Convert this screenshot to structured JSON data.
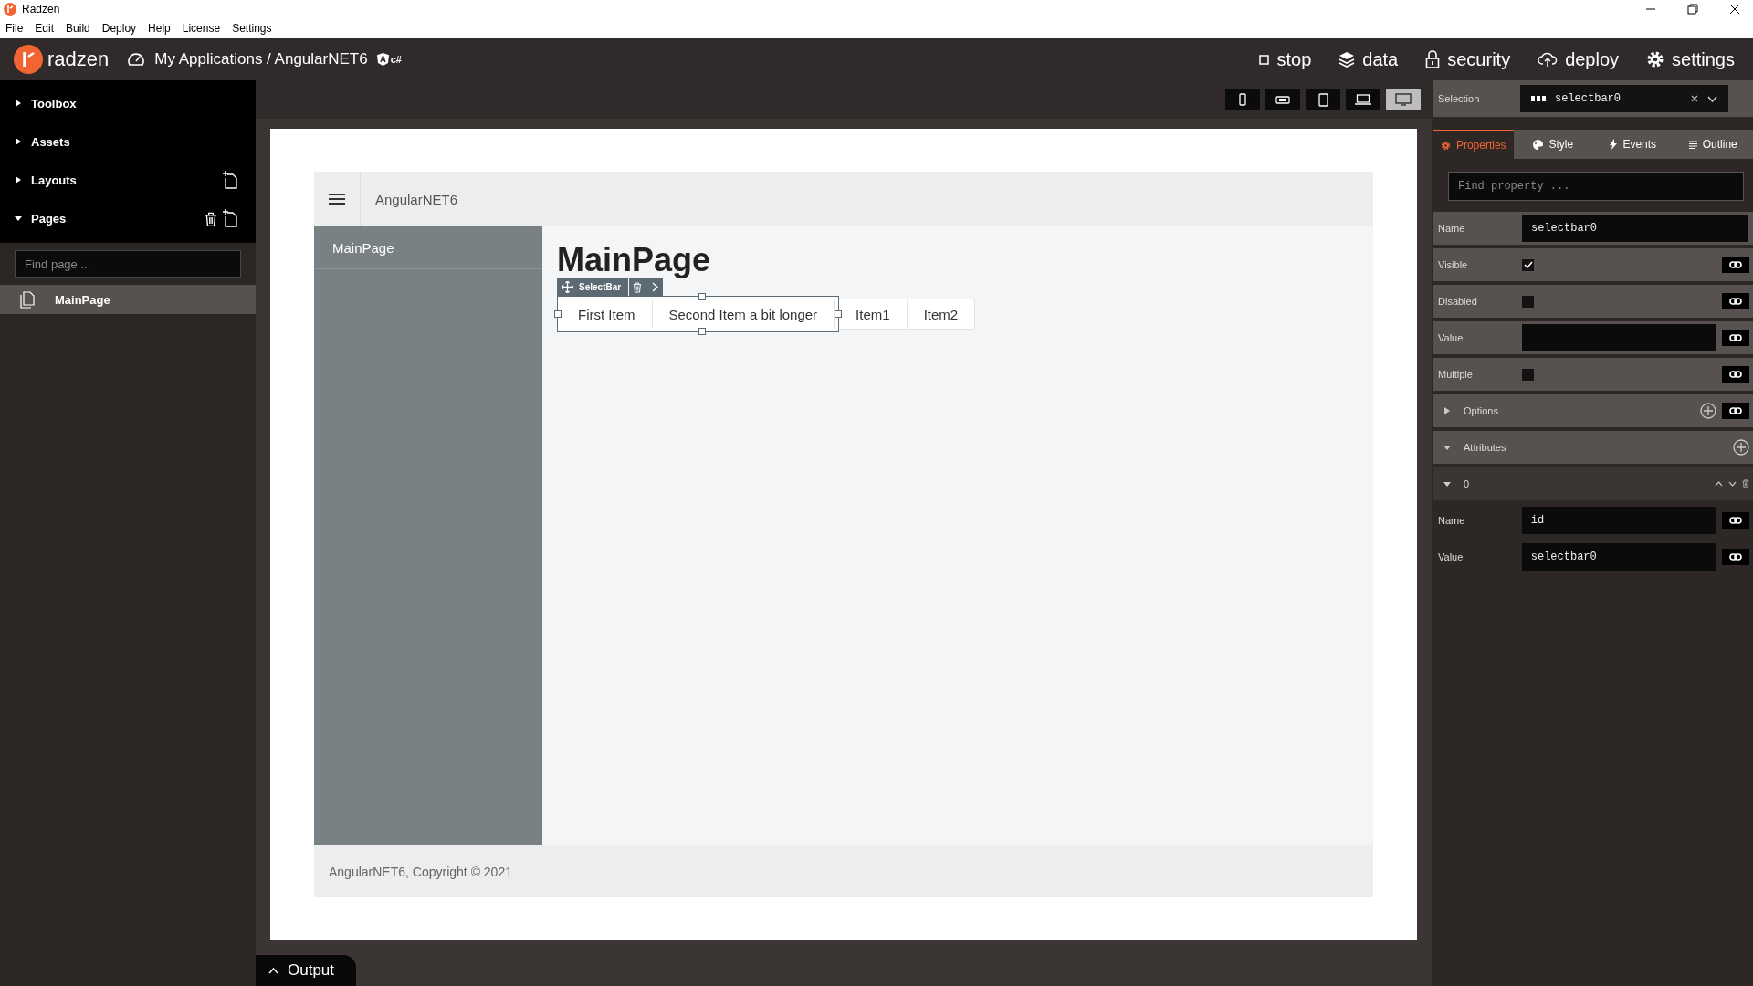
{
  "window": {
    "title": "Radzen"
  },
  "menu": [
    "File",
    "Edit",
    "Build",
    "Deploy",
    "Help",
    "License",
    "Settings"
  ],
  "header": {
    "logo_text": "radzen",
    "breadcrumb": "My Applications / AngularNET6",
    "badge": "c#",
    "actions": [
      {
        "kind": "stop",
        "label": "stop"
      },
      {
        "kind": "data",
        "label": "data"
      },
      {
        "kind": "security",
        "label": "security"
      },
      {
        "kind": "deploy",
        "label": "deploy"
      },
      {
        "kind": "settings",
        "label": "settings"
      }
    ]
  },
  "sidebar": {
    "sections": [
      {
        "label": "Toolbox",
        "expanded": false,
        "can_add": false,
        "can_delete": false
      },
      {
        "label": "Assets",
        "expanded": false,
        "can_add": false,
        "can_delete": false
      },
      {
        "label": "Layouts",
        "expanded": false,
        "can_add": true,
        "can_delete": false
      },
      {
        "label": "Pages",
        "expanded": true,
        "can_add": true,
        "can_delete": true
      }
    ],
    "search": {
      "placeholder": "Find page ..."
    },
    "pages": [
      {
        "label": "MainPage",
        "selected": true
      }
    ]
  },
  "devices": [
    {
      "kind": "phone",
      "selected": false
    },
    {
      "kind": "phone-landscape",
      "selected": false
    },
    {
      "kind": "tablet",
      "selected": false
    },
    {
      "kind": "laptop",
      "selected": false
    },
    {
      "kind": "desktop",
      "selected": true
    }
  ],
  "canvas": {
    "app_title": "AngularNET6",
    "nav_items": [
      {
        "label": "MainPage"
      }
    ],
    "heading": "MainPage",
    "selection_label": "SelectBar",
    "selectbar_items": [
      {
        "label": "First Item",
        "outlined": true
      },
      {
        "label": "Second Item a bit longer",
        "outlined": true
      },
      {
        "label": "Item1",
        "outlined": false
      },
      {
        "label": "Item2",
        "outlined": false
      }
    ],
    "footer": "AngularNET6, Copyright © 2021"
  },
  "properties": {
    "selection": {
      "label": "Selection",
      "value": "selectbar0"
    },
    "tabs": [
      {
        "kind": "properties",
        "label": "Properties",
        "selected": true
      },
      {
        "kind": "style",
        "label": "Style",
        "selected": false
      },
      {
        "kind": "events",
        "label": "Events",
        "selected": false
      },
      {
        "kind": "outline",
        "label": "Outline",
        "selected": false
      }
    ],
    "search": {
      "placeholder": "Find property ..."
    },
    "rows": [
      {
        "kind": "text",
        "label": "Name",
        "value": "selectbar0",
        "bindable": false
      },
      {
        "kind": "checkbox",
        "label": "Visible",
        "checked": true
      },
      {
        "kind": "checkbox",
        "label": "Disabled",
        "checked": false
      },
      {
        "kind": "text",
        "label": "Value",
        "bindable": true
      },
      {
        "kind": "checkbox",
        "label": "Multiple",
        "checked": false
      },
      {
        "kind": "group",
        "label": "Options",
        "expanded": false,
        "bindable": true
      },
      {
        "kind": "group",
        "label": "Attributes",
        "expanded": true,
        "bindable": false
      },
      {
        "kind": "item",
        "label": "0",
        "expanded": true
      },
      {
        "kind": "text",
        "label": "Name",
        "value": "id",
        "bindable": true
      },
      {
        "kind": "text",
        "label": "Value",
        "value": "selectbar0",
        "bindable": true
      }
    ]
  },
  "output": {
    "label": "Output",
    "expanded": false
  }
}
